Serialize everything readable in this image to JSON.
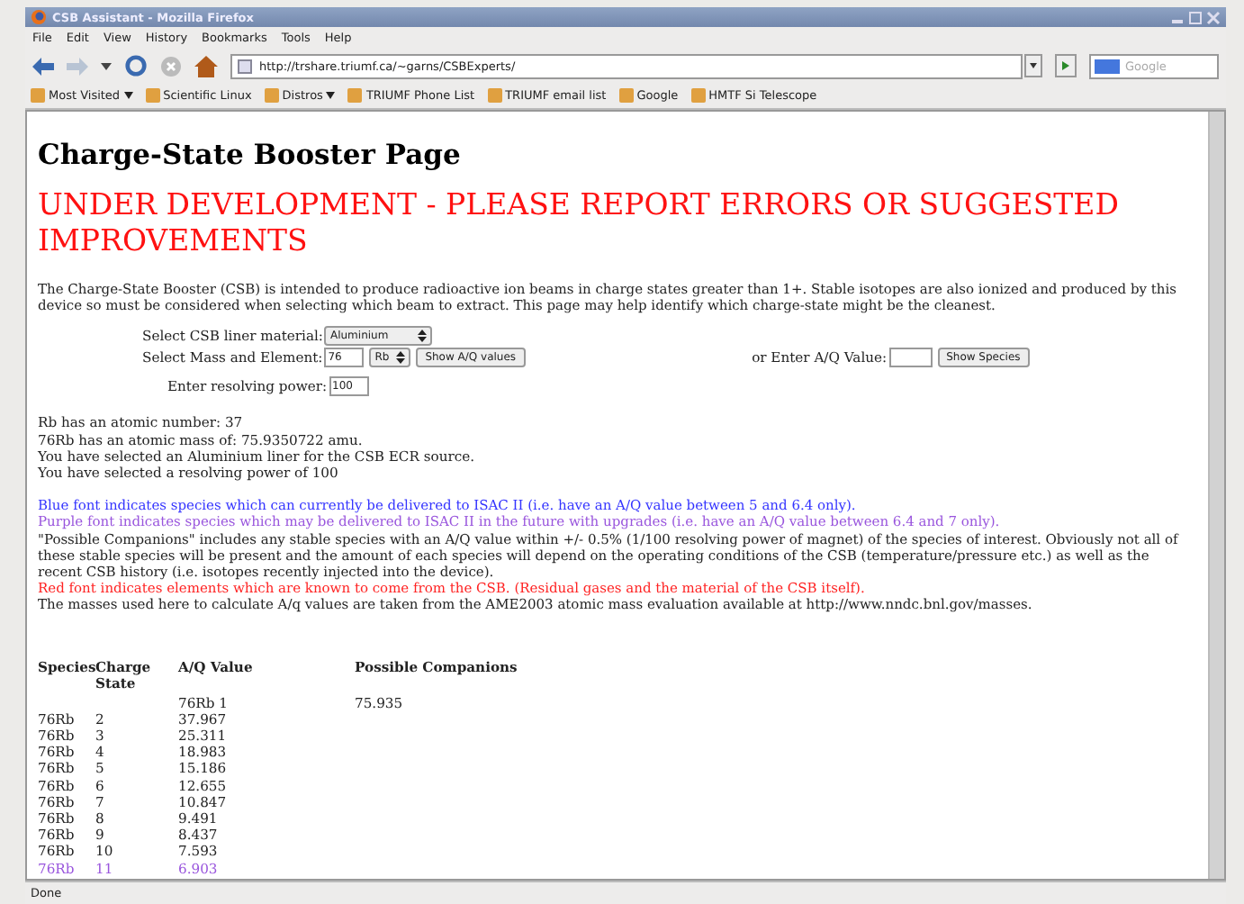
{
  "window": {
    "title": "CSB Assistant - Mozilla Firefox"
  },
  "menu": [
    "File",
    "Edit",
    "View",
    "History",
    "Bookmarks",
    "Tools",
    "Help"
  ],
  "address": {
    "value": "http://trshare.triumf.ca/~garns/CSBExperts/"
  },
  "search": {
    "placeholder": "Google"
  },
  "bookmarks": [
    {
      "label": "Most Visited",
      "dropdown": true
    },
    {
      "label": "Scientific Linux",
      "dropdown": false
    },
    {
      "label": "Distros",
      "dropdown": true
    },
    {
      "label": "TRIUMF Phone List",
      "dropdown": false
    },
    {
      "label": "TRIUMF email list",
      "dropdown": false
    },
    {
      "label": "Google",
      "dropdown": false
    },
    {
      "label": "HMTF Si Telescope",
      "dropdown": false
    }
  ],
  "page": {
    "title": "Charge-State Booster Page",
    "warning": "UNDER DEVELOPMENT - PLEASE REPORT ERRORS OR SUGGESTED IMPROVEMENTS",
    "intro": "The Charge-State Booster (CSB) is intended to produce radioactive ion beams in charge states greater than 1+. Stable isotopes are also ionized and produced by this device so must be considered when selecting which beam to extract. This page may help identify which charge-state might be the cleanest.",
    "form": {
      "liner_label": "Select CSB liner material:",
      "liner_value": "Aluminium",
      "mass_label": "Select Mass and Element:",
      "mass_value": "76",
      "element_value": "Rb",
      "show_aq_button": "Show A/Q values",
      "aq_label": "or Enter A/Q Value:",
      "show_species_button": "Show Species",
      "power_label": "Enter resolving power:",
      "power_value": "100"
    },
    "info": [
      "Rb has an atomic number: 37",
      "76Rb has an atomic mass of: 75.9350722 amu.",
      "You have selected an Aluminium liner for the CSB ECR source.",
      "You have selected a resolving power of 100"
    ],
    "legend": [
      {
        "text": "Blue font indicates species which can currently be delivered to ISAC II (i.e. have an A/Q value between 5 and 6.4 only).",
        "color": "#3333ff"
      },
      {
        "text": "Purple font indicates species which may be delivered to ISAC II in the future with upgrades (i.e. have an A/Q value between 6.4 and 7 only).",
        "color": "#9955dd"
      },
      {
        "text": "\"Possible Companions\" includes any stable species with an A/Q value within +/- 0.5% (1/100 resolving power of magnet) of the species of interest. Obviously not all of these stable species will be present and the amount of each species will depend on the operating conditions of the CSB (temperature/pressure etc.) as well as the recent CSB history (i.e. isotopes recently injected into the device).",
        "color": "#222222"
      },
      {
        "text": "Red font indicates elements which are known to come from the CSB. (Residual gases and the material of the CSB itself).",
        "color": "#ff2222"
      },
      {
        "text": "The masses used here to calculate A/q values are taken from the AME2003 atomic mass evaluation available at http://www.nndc.bnl.gov/masses.",
        "color": "#222222"
      }
    ]
  },
  "table": {
    "columns": [
      "Species",
      "Charge State",
      "A/Q Value",
      "Possible Companions"
    ],
    "rows": [
      {
        "kind": "normal",
        "cells": [
          "",
          "",
          "76Rb 1",
          "75.935"
        ],
        "color": "#222222"
      },
      {
        "kind": "normal",
        "cells": [
          "76Rb",
          "2",
          "37.967"
        ],
        "color": "#222222"
      },
      {
        "kind": "normal",
        "cells": [
          "76Rb",
          "3",
          "25.311"
        ],
        "color": "#222222"
      },
      {
        "kind": "normal",
        "cells": [
          "76Rb",
          "4",
          "18.983"
        ],
        "color": "#222222"
      },
      {
        "kind": "normal",
        "cells": [
          "76Rb",
          "5",
          "15.186"
        ],
        "color": "#222222"
      },
      {
        "kind": "normal",
        "cells": [
          "76Rb",
          "6",
          "12.655"
        ],
        "color": "#222222"
      },
      {
        "kind": "normal",
        "cells": [
          "76Rb",
          "7",
          "10.847"
        ],
        "color": "#222222"
      },
      {
        "kind": "normal",
        "cells": [
          "76Rb",
          "8",
          "9.491"
        ],
        "color": "#222222"
      },
      {
        "kind": "normal",
        "cells": [
          "76Rb",
          "9",
          "8.437"
        ],
        "color": "#222222"
      },
      {
        "kind": "normal",
        "cells": [
          "76Rb",
          "10",
          "7.593"
        ],
        "color": "#222222"
      },
      {
        "kind": "normal",
        "cells": [
          "76Rb",
          "11",
          "6.903"
        ],
        "color": "#9955dd"
      }
    ]
  },
  "status_bar": "Done"
}
